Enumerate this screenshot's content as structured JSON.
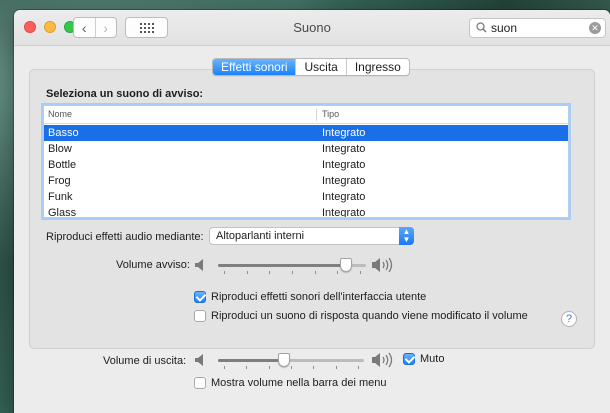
{
  "window": {
    "title": "Suono"
  },
  "toolbar": {
    "back_glyph": "‹",
    "forward_glyph": "›",
    "grid_icon": "grid-icon"
  },
  "search": {
    "value": "suon",
    "placeholder": "Cerca"
  },
  "tabs": [
    {
      "label": "Effetti sonori",
      "active": true
    },
    {
      "label": "Uscita",
      "active": false
    },
    {
      "label": "Ingresso",
      "active": false
    }
  ],
  "alert": {
    "heading": "Seleziona un suono di avviso:",
    "columns": [
      "Nome",
      "Tipo"
    ],
    "rows": [
      {
        "name": "Basso",
        "type": "Integrato",
        "selected": true
      },
      {
        "name": "Blow",
        "type": "Integrato",
        "selected": false
      },
      {
        "name": "Bottle",
        "type": "Integrato",
        "selected": false
      },
      {
        "name": "Frog",
        "type": "Integrato",
        "selected": false
      },
      {
        "name": "Funk",
        "type": "Integrato",
        "selected": false
      },
      {
        "name": "Glass",
        "type": "Integrato",
        "selected": false
      }
    ]
  },
  "play_through": {
    "label": "Riproduci effetti audio mediante:",
    "value": "Altoparlanti interni"
  },
  "alert_volume": {
    "label": "Volume avviso:",
    "level": 0.9
  },
  "options": {
    "ui_effects": {
      "label": "Riproduci effetti sonori dell'interfaccia utente",
      "checked": true
    },
    "feedback": {
      "label": "Riproduci un suono di risposta quando viene modificato il volume",
      "checked": false
    }
  },
  "output_volume": {
    "label": "Volume di uscita:",
    "level": 0.45,
    "mute_label": "Muto",
    "muted": true
  },
  "menu_bar": {
    "label": "Mostra volume nella barra dei menu",
    "checked": false
  },
  "help": {
    "glyph": "?"
  },
  "colors": {
    "accent": "#1a82fb",
    "selection": "#1a6ee6",
    "window_bg": "#ececec"
  }
}
